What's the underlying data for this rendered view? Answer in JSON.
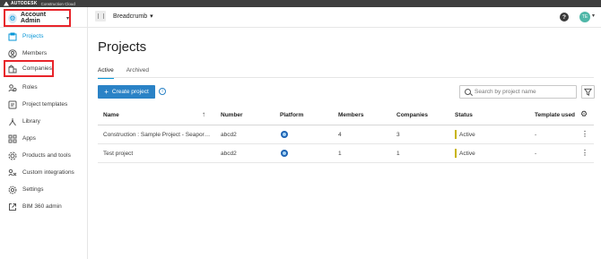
{
  "brand": {
    "name": "AUTODESK",
    "product": "Construction Cloud"
  },
  "header": {
    "account_label": "Account Admin",
    "breadcrumb": "Breadcrumb",
    "help_icon": "?",
    "user_initials": "TE"
  },
  "sidebar": {
    "items": [
      {
        "label": "Projects",
        "icon": "projects-icon",
        "active": true
      },
      {
        "label": "Members",
        "icon": "members-icon"
      },
      {
        "label": "Companies",
        "icon": "companies-icon"
      },
      {
        "label": "Roles",
        "icon": "roles-icon"
      },
      {
        "label": "Project templates",
        "icon": "templates-icon"
      },
      {
        "label": "Library",
        "icon": "library-icon"
      },
      {
        "label": "Apps",
        "icon": "apps-icon"
      },
      {
        "label": "Products and tools",
        "icon": "products-icon"
      },
      {
        "label": "Custom integrations",
        "icon": "integrations-icon"
      },
      {
        "label": "Settings",
        "icon": "settings-icon"
      },
      {
        "label": "BIM 360 admin",
        "icon": "external-link-icon"
      }
    ]
  },
  "main": {
    "title": "Projects",
    "tabs": [
      {
        "label": "Active",
        "active": true
      },
      {
        "label": "Archived"
      }
    ],
    "create_button": "Create project",
    "search_placeholder": "Search by project name"
  },
  "table": {
    "columns": [
      "Name",
      "Number",
      "Platform",
      "Members",
      "Companies",
      "Status",
      "Template used"
    ],
    "rows": [
      {
        "name": "Construction : Sample Project - Seapor…",
        "number": "abcd2",
        "members": "4",
        "companies": "3",
        "status": "Active",
        "template": "-"
      },
      {
        "name": "Test project",
        "number": "abcd2",
        "members": "1",
        "companies": "1",
        "status": "Active",
        "template": "-"
      }
    ]
  },
  "colors": {
    "accent": "#0696d7",
    "button": "#2a82c6",
    "highlight": "#e8242a",
    "status_active": "#c8b400"
  }
}
